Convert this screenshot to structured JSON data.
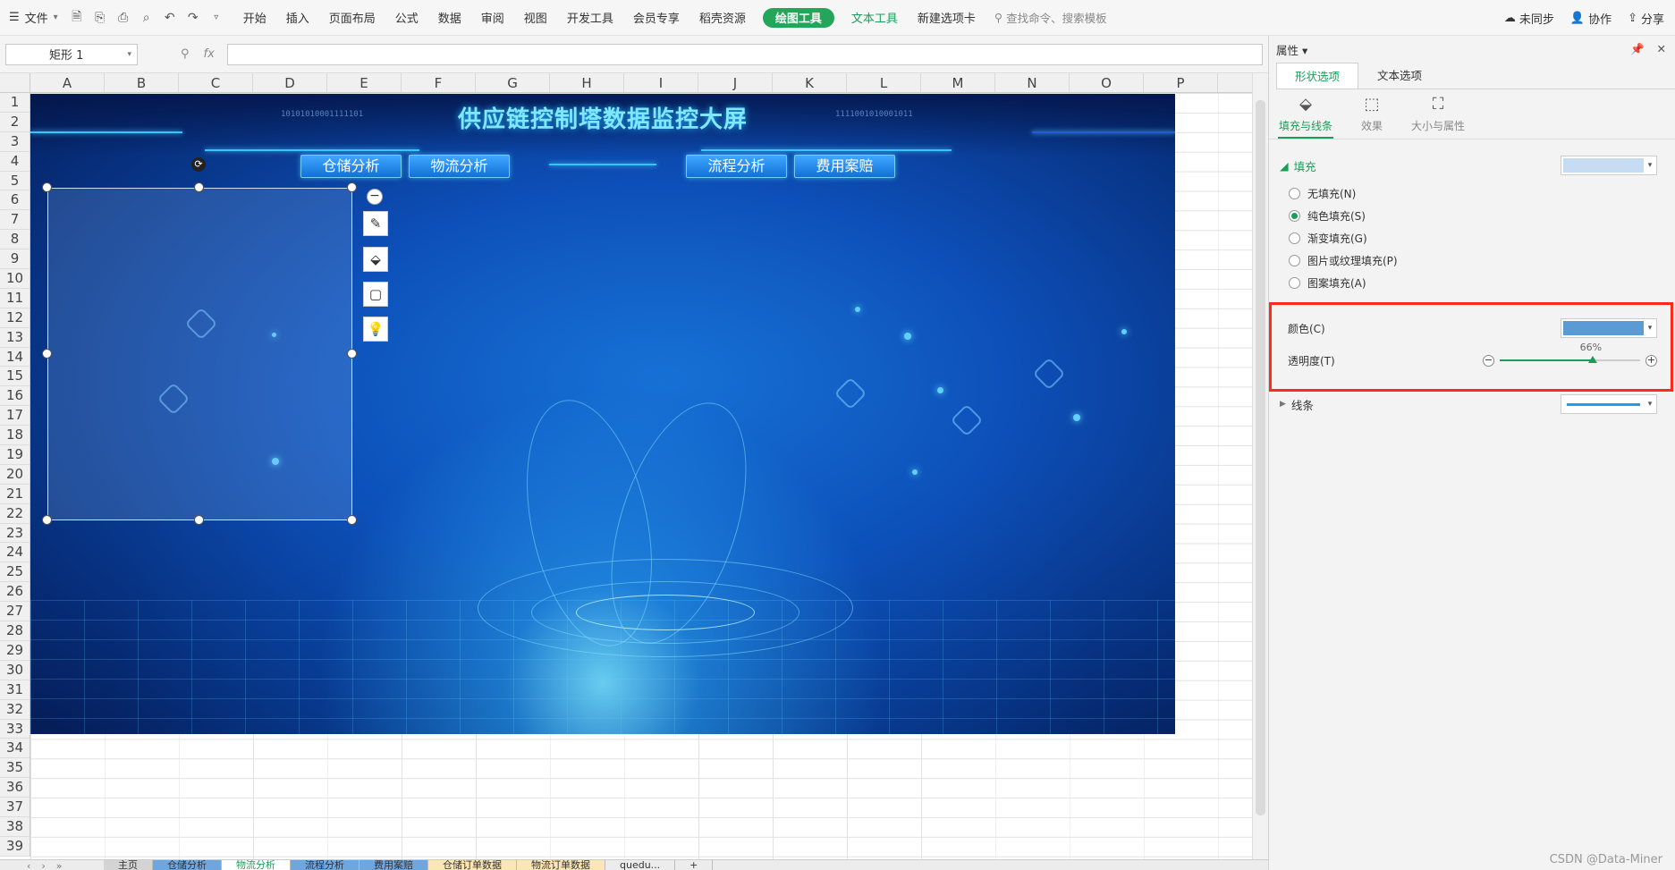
{
  "menubar": {
    "file_label": "文件",
    "items": [
      "开始",
      "插入",
      "页面布局",
      "公式",
      "数据",
      "审阅",
      "视图",
      "开发工具",
      "会员专享",
      "稻壳资源"
    ],
    "drawing_tools": "绘图工具",
    "text_tools": "文本工具",
    "new_tab": "新建选项卡",
    "search_placeholder": "查找命令、搜索模板",
    "sync": "未同步",
    "collab": "协作",
    "share": "分享"
  },
  "formula": {
    "name_box": "矩形 1",
    "fx": "fx"
  },
  "grid": {
    "columns": [
      "A",
      "B",
      "C",
      "D",
      "E",
      "F",
      "G",
      "H",
      "I",
      "J",
      "K",
      "L",
      "M",
      "N",
      "O",
      "P"
    ],
    "rows": [
      "1",
      "2",
      "3",
      "4",
      "5",
      "6",
      "7",
      "8",
      "9",
      "10",
      "11",
      "12",
      "13",
      "14",
      "15",
      "16",
      "17",
      "18",
      "19",
      "20",
      "21",
      "22",
      "23",
      "24",
      "25",
      "26",
      "27",
      "28",
      "29",
      "30",
      "31",
      "32",
      "33",
      "34",
      "35",
      "36",
      "37",
      "38",
      "39"
    ]
  },
  "dashboard": {
    "title": "供应链控制塔数据监控大屏",
    "nav": [
      "仓储分析",
      "物流分析",
      "流程分析",
      "费用案赔"
    ],
    "binary_left": "10101010001111101",
    "binary_right": "1111001010001011"
  },
  "sheet_tabs": [
    "主页",
    "仓储分析",
    "物流分析",
    "流程分析",
    "费用案赔",
    "仓储订单数据",
    "物流订单数据",
    "quedu..."
  ],
  "pane": {
    "title": "属性",
    "tabs": [
      "形状选项",
      "文本选项"
    ],
    "subtabs": [
      "填充与线条",
      "效果",
      "大小与属性"
    ],
    "fill_section": "填充",
    "fill_options": [
      "无填充(N)",
      "纯色填充(S)",
      "渐变填充(G)",
      "图片或纹理填充(P)",
      "图案填充(A)"
    ],
    "selected_fill": 1,
    "color_label": "颜色(C)",
    "transparency_label": "透明度(T)",
    "transparency_value": "66%",
    "transparency": 0.66,
    "line_section": "线条"
  },
  "colors": {
    "fill_preview": "#c6dcf2",
    "fill_color": "#5b9bd5",
    "line_color": "#1aa0e8",
    "accent": "#1a9e57",
    "highlight": "#ff2a1a"
  },
  "watermark": "CSDN @Data-Miner"
}
